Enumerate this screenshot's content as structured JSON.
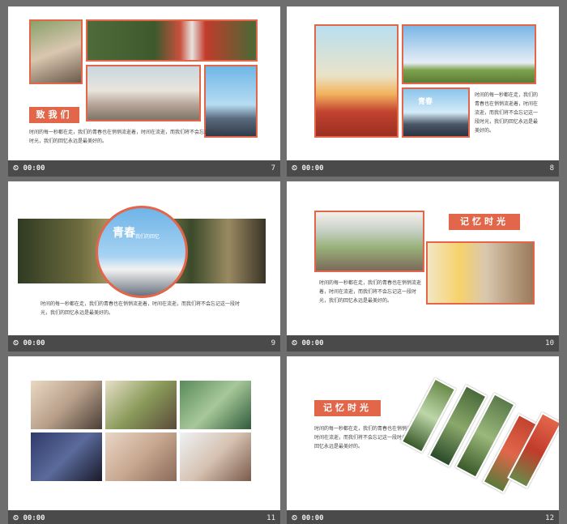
{
  "slides": [
    {
      "number": "7",
      "time": "00:00",
      "tag": "致我们",
      "body": "时间的每一秒都在走，我们的青春也在悄悄流逝着，时间在流逝，而我们将不会忘记这一段时光，我们的回忆永远是最美好的。"
    },
    {
      "number": "8",
      "time": "00:00",
      "photo_caption": "青春",
      "body": "时间的每一秒都在走，我们的青春也在悄悄流逝着，时间在流逝，而我们将不会忘记这一段时光，我们的回忆永远是最美好的。"
    },
    {
      "number": "9",
      "time": "00:00",
      "circle_title": "青春",
      "circle_sub": "我们的回忆",
      "body": "时间的每一秒都在走，我们的青春也在悄悄流逝着，时间在流逝，而我们将不会忘记这一段时光，我们的回忆永远是最美好的。"
    },
    {
      "number": "10",
      "time": "00:00",
      "tag": "记忆时光",
      "body": "时间的每一秒都在走，我们的青春也在悄悄流逝着，时间在流逝，而我们将不会忘记这一段时光，我们的回忆永远是最美好的。"
    },
    {
      "number": "11",
      "time": "00:00"
    },
    {
      "number": "12",
      "time": "00:00",
      "tag": "记忆时光",
      "body": "时间的每一秒都在走，我们的青春也在悄悄流逝着，时间在流逝，而我们将不会忘记这一段时光，我们的回忆永远是最美好的。"
    }
  ],
  "clock_icon": "clock-icon"
}
